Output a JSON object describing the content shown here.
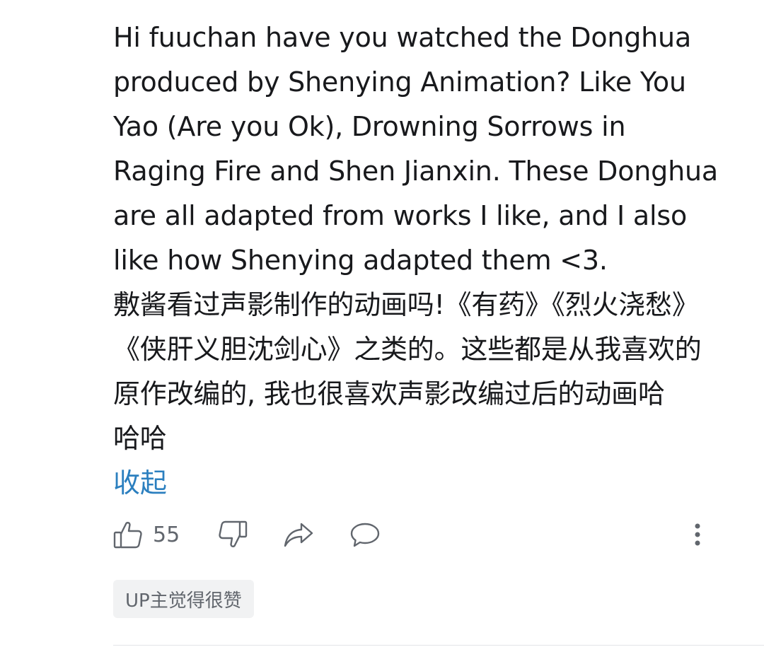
{
  "comment": {
    "text": "Hi fuuchan have you watched the Donghua\nproduced by Shenying Animation? Like You\nYao (Are you Ok), Drowning Sorrows in\nRaging Fire and Shen Jianxin. These Donghua\nare all adapted from works I like, and I also\nlike how Shenying adapted them <3.\n敷酱看过声影制作的动画吗!《有药》《烈火浇愁》\n《侠肝义胆沈剑心》之类的。这些都是从我喜欢的\n原作改编的, 我也很喜欢声影改编过后的动画哈\n哈哈",
    "collapse_label": "收起"
  },
  "actions": {
    "like_count": "55",
    "icons": [
      "thumbs-up-icon",
      "thumbs-down-icon",
      "share-icon",
      "reply-icon",
      "more-icon"
    ]
  },
  "badge": {
    "label": "UP主觉得很赞"
  },
  "colors": {
    "text": "#18191c",
    "link": "#2b7fbf",
    "icon": "#61666d",
    "badge_bg": "#f1f2f3"
  }
}
